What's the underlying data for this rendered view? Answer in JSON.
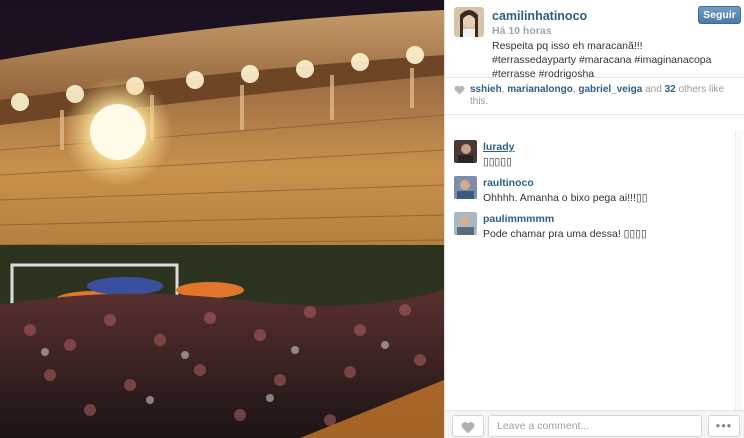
{
  "photo": {
    "subject": "stadium-night-party"
  },
  "post": {
    "username": "camilinhatinoco",
    "time_ago": "Há 10 horas",
    "caption": "Respeita pq isso eh maracanã!!! #terrassedayparty #maracana #imaginanacopa #terrasse #rodrigosha",
    "follow_label": "Seguir"
  },
  "likes": {
    "users": [
      "sshieh",
      "marianalongo",
      "gabriel_veiga"
    ],
    "sep1": ", ",
    "sep2": ", ",
    "and": " and ",
    "others_count": "32",
    "others_suffix": " others like this."
  },
  "comments": [
    {
      "username": "lurady",
      "text": "▯▯▯▯▯"
    },
    {
      "username": "raultinoco",
      "text": "Ohhhh. Amanha o bixo pega ai!!!▯▯"
    },
    {
      "username": "paulimmmmm",
      "text": "Pode chamar pra uma dessa! ▯▯▯▯"
    }
  ],
  "footer": {
    "comment_placeholder": "Leave a comment...",
    "more_label": "•••"
  },
  "colors": {
    "link": "#2e5e86",
    "button": "#517fa4",
    "muted": "#999999"
  }
}
